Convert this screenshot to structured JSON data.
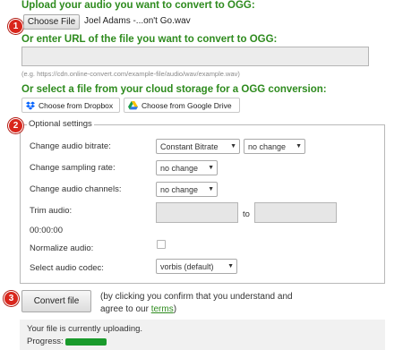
{
  "upload": {
    "heading": "Upload your audio you want to convert to OGG:",
    "step": "1",
    "choose_file_label": "Choose File",
    "file_name": "Joel Adams -...on't Go.wav"
  },
  "url_section": {
    "heading": "Or enter URL of the file you want to convert to OGG:",
    "input_value": "",
    "example": "(e.g. https://cdn.online-convert.com/example-file/audio/wav/example.wav)"
  },
  "cloud": {
    "heading": "Or select a file from your cloud storage for a OGG conversion:",
    "dropbox_label": "Choose from Dropbox",
    "gdrive_label": "Choose from Google Drive"
  },
  "settings": {
    "step": "2",
    "legend": "Optional settings",
    "bitrate_label": "Change audio bitrate:",
    "bitrate_mode": "Constant Bitrate",
    "bitrate_value": "no change",
    "sampling_label": "Change sampling rate:",
    "sampling_value": "no change",
    "channels_label": "Change audio channels:",
    "channels_value": "no change",
    "trim_label": "Trim audio:",
    "trim_to": "to",
    "trim_start": "",
    "trim_end": "",
    "time_display": "00:00:00",
    "normalize_label": "Normalize audio:",
    "normalize_checked": false,
    "codec_label": "Select audio codec:",
    "codec_value": "vorbis (default)"
  },
  "convert": {
    "step": "3",
    "button_label": "Convert file",
    "note_line1": "(by clicking you confirm that you understand and",
    "note_line2_prefix": "agree to our ",
    "terms_link": "terms",
    "note_line2_suffix": ")"
  },
  "status": {
    "message": "Your file is currently uploading.",
    "progress_label": "Progress:",
    "progress_fraction": 0.16,
    "bar_color": "#1a9a2c"
  },
  "colors": {
    "heading_green": "#2e8b1e",
    "step_red": "#d9261c"
  }
}
